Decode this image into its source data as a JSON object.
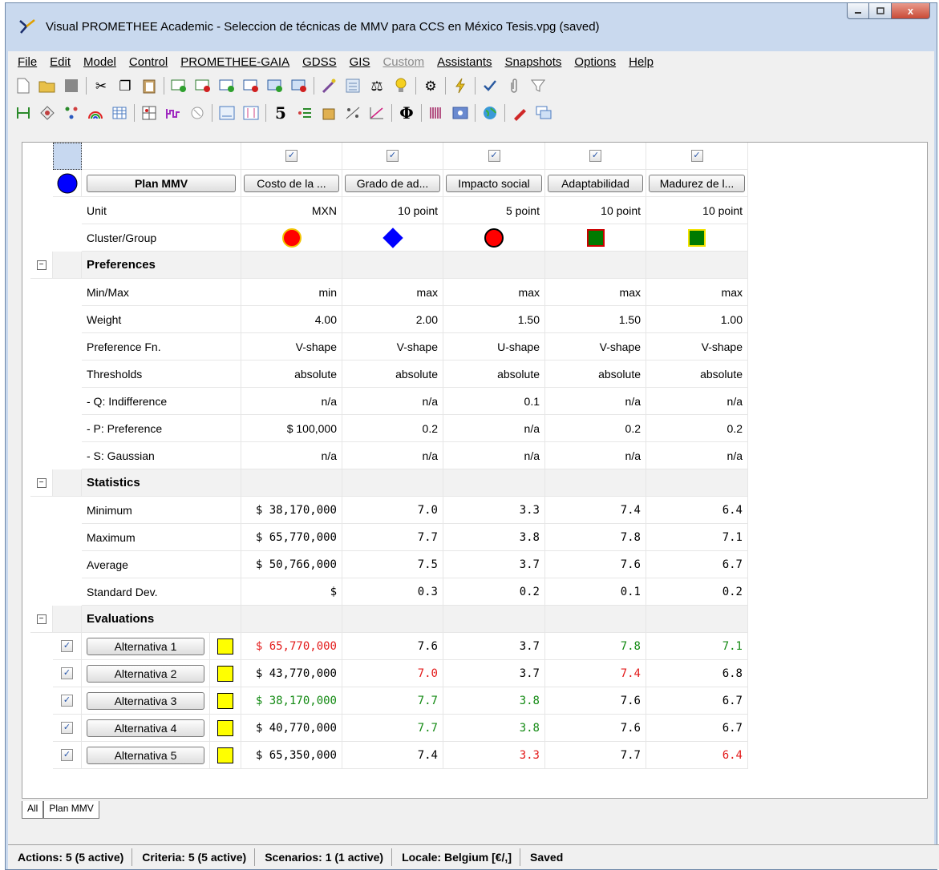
{
  "window": {
    "title": "Visual PROMETHEE Academic - Seleccion de técnicas de MMV para CCS en México Tesis.vpg (saved)",
    "close_glyph": "x"
  },
  "menu": [
    "File",
    "Edit",
    "Model",
    "Control",
    "PROMETHEE-GAIA",
    "GDSS",
    "GIS",
    "Custom",
    "Assistants",
    "Snapshots",
    "Options",
    "Help"
  ],
  "toolbar_number": "5",
  "toolbar_phi": "Φ",
  "grid": {
    "header_button": "Plan MMV",
    "criteria": [
      "Costo de la ...",
      "Grado de ad...",
      "Impacto social",
      "Adaptabilidad",
      "Madurez de l..."
    ],
    "unit_label": "Unit",
    "units": [
      "MXN",
      "10 point",
      "5 point",
      "10 point",
      "10 point"
    ],
    "cluster_label": "Cluster/Group",
    "cluster_markers": [
      {
        "shape": "circle",
        "fill": "#ff0000",
        "stroke": "#f2c200"
      },
      {
        "shape": "diamond",
        "fill": "#0000ff",
        "stroke": "#0000ff"
      },
      {
        "shape": "circle",
        "fill": "#ff0000",
        "stroke": "#000000"
      },
      {
        "shape": "square",
        "fill": "#007a00",
        "stroke": "#cc0000"
      },
      {
        "shape": "square",
        "fill": "#007a00",
        "stroke": "#f2e200"
      }
    ],
    "sections": {
      "preferences": "Preferences",
      "statistics": "Statistics",
      "evaluations": "Evaluations"
    },
    "preferences": [
      {
        "label": "Min/Max",
        "values": [
          "min",
          "max",
          "max",
          "max",
          "max"
        ]
      },
      {
        "label": "Weight",
        "values": [
          "4.00",
          "2.00",
          "1.50",
          "1.50",
          "1.00"
        ]
      },
      {
        "label": "Preference Fn.",
        "values": [
          "V-shape",
          "V-shape",
          "U-shape",
          "V-shape",
          "V-shape"
        ]
      },
      {
        "label": "Thresholds",
        "values": [
          "absolute",
          "absolute",
          "absolute",
          "absolute",
          "absolute"
        ]
      },
      {
        "label": "- Q: Indifference",
        "values": [
          "n/a",
          "n/a",
          "0.1",
          "n/a",
          "n/a"
        ]
      },
      {
        "label": "- P: Preference",
        "values": [
          "$ 100,000",
          "0.2",
          "n/a",
          "0.2",
          "0.2"
        ]
      },
      {
        "label": "- S: Gaussian",
        "values": [
          "n/a",
          "n/a",
          "n/a",
          "n/a",
          "n/a"
        ]
      }
    ],
    "statistics": [
      {
        "label": "Minimum",
        "values": [
          "$ 38,170,000",
          "7.0",
          "3.3",
          "7.4",
          "6.4"
        ]
      },
      {
        "label": "Maximum",
        "values": [
          "$ 65,770,000",
          "7.7",
          "3.8",
          "7.8",
          "7.1"
        ]
      },
      {
        "label": "Average",
        "values": [
          "$ 50,766,000",
          "7.5",
          "3.7",
          "7.6",
          "6.7"
        ]
      },
      {
        "label": "Standard Dev.",
        "values": [
          "$",
          "0.3",
          "0.2",
          "0.1",
          "0.2"
        ]
      }
    ],
    "alternatives": [
      {
        "name": "Alternativa 1",
        "color": "#ffff00",
        "values": [
          "$ 65,770,000",
          "7.6",
          "3.7",
          "7.8",
          "7.1"
        ],
        "tone": [
          "red",
          "",
          "",
          "green",
          "green"
        ]
      },
      {
        "name": "Alternativa 2",
        "color": "#ffff00",
        "values": [
          "$ 43,770,000",
          "7.0",
          "3.7",
          "7.4",
          "6.8"
        ],
        "tone": [
          "",
          "red",
          "",
          "red",
          ""
        ]
      },
      {
        "name": "Alternativa 3",
        "color": "#ffff00",
        "values": [
          "$ 38,170,000",
          "7.7",
          "3.8",
          "7.6",
          "6.7"
        ],
        "tone": [
          "green",
          "green",
          "green",
          "",
          ""
        ]
      },
      {
        "name": "Alternativa 4",
        "color": "#ffff00",
        "values": [
          "$ 40,770,000",
          "7.7",
          "3.8",
          "7.6",
          "6.7"
        ],
        "tone": [
          "",
          "green",
          "green",
          "",
          ""
        ]
      },
      {
        "name": "Alternativa 5",
        "color": "#ffff00",
        "values": [
          "$ 65,350,000",
          "7.4",
          "3.3",
          "7.7",
          "6.4"
        ],
        "tone": [
          "",
          "",
          "red",
          "",
          "red"
        ]
      }
    ]
  },
  "tabs": [
    "All",
    "Plan MMV"
  ],
  "status": {
    "actions": "Actions: 5 (5 active)",
    "criteria": "Criteria: 5 (5 active)",
    "scenarios": "Scenarios: 1 (1 active)",
    "locale": "Locale: Belgium [€/,]",
    "saved": "Saved"
  },
  "colors": {
    "accent": "#0000ff",
    "positive": "#138a13",
    "negative": "#e31b1b",
    "alt_marker": "#ffff00"
  }
}
